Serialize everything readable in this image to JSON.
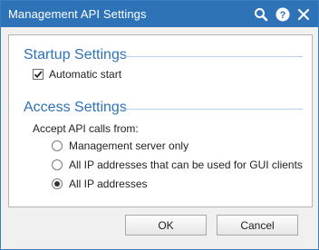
{
  "window": {
    "title": "Management API Settings",
    "title_icons": [
      "search-icon",
      "help-icon",
      "close-icon"
    ],
    "accent_color": "#2e73b8"
  },
  "startup": {
    "title": "Startup Settings",
    "automatic_start_label": "Automatic start",
    "automatic_start_checked": true
  },
  "access": {
    "title": "Access Settings",
    "accept_label": "Accept API calls from:",
    "options": [
      {
        "label": "Management server only",
        "selected": false
      },
      {
        "label": "All IP addresses that can be used for GUI clients",
        "selected": false
      },
      {
        "label": "All IP addresses",
        "selected": true
      }
    ]
  },
  "buttons": {
    "ok": "OK",
    "cancel": "Cancel"
  }
}
